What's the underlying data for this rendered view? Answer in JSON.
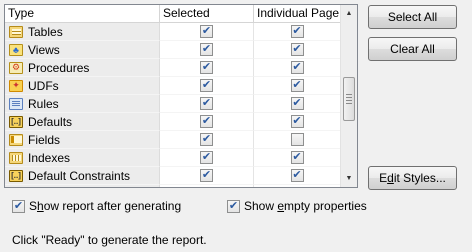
{
  "table": {
    "columns": [
      "Type",
      "Selected",
      "Individual Page"
    ],
    "rows": [
      {
        "label": "Tables",
        "icon": "table-icon",
        "selected": true,
        "individual": true
      },
      {
        "label": "Views",
        "icon": "view-icon",
        "selected": true,
        "individual": true
      },
      {
        "label": "Procedures",
        "icon": "procedure-icon",
        "selected": true,
        "individual": true
      },
      {
        "label": "UDFs",
        "icon": "udf-icon",
        "selected": true,
        "individual": true
      },
      {
        "label": "Rules",
        "icon": "rule-icon",
        "selected": true,
        "individual": true
      },
      {
        "label": "Defaults",
        "icon": "default-icon",
        "selected": true,
        "individual": true
      },
      {
        "label": "Fields",
        "icon": "field-icon",
        "selected": true,
        "individual": false
      },
      {
        "label": "Indexes",
        "icon": "index-icon",
        "selected": true,
        "individual": true
      },
      {
        "label": "Default Constraints",
        "icon": "default-constraint-icon",
        "selected": true,
        "individual": true
      }
    ]
  },
  "buttons": {
    "select_all": "Select All",
    "clear_all": "Clear All",
    "edit_styles_prefix": "E",
    "edit_styles_key": "d",
    "edit_styles_suffix": "it Styles..."
  },
  "options": {
    "show_report_prefix": "S",
    "show_report_key": "h",
    "show_report_suffix": "ow report after generating",
    "show_report_checked": true,
    "show_empty_prefix": "Show ",
    "show_empty_key": "e",
    "show_empty_suffix": "mpty properties",
    "show_empty_checked": true
  },
  "hint": "Click \"Ready\" to generate the report."
}
